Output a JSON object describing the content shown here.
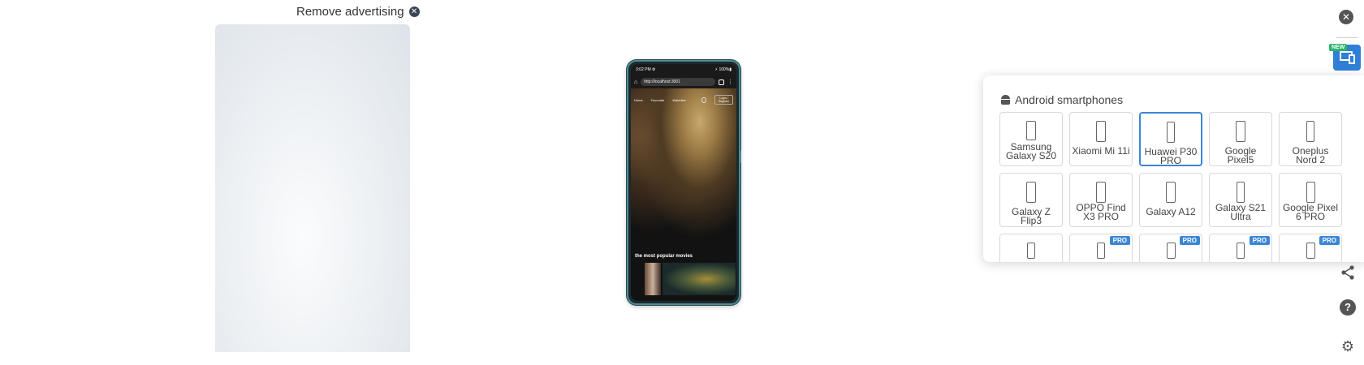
{
  "ad": {
    "remove_label": "Remove advertising",
    "close_glyph": "✕"
  },
  "phone": {
    "status_time": "3:02 PM ⚙",
    "status_battery": "⚡ 100%▮",
    "url": "http://localhost:3001",
    "nav_items": [
      "Home",
      "Favourite",
      "Watchlist"
    ],
    "login_label": "Login / Register",
    "section_title": "the most popular movies"
  },
  "popup": {
    "title": "Android smartphones",
    "icon": "android-icon",
    "devices": [
      {
        "label": "Samsung Galaxy S20",
        "pro": false,
        "selected": false
      },
      {
        "label": "Xiaomi Mi 11i",
        "pro": false,
        "selected": false
      },
      {
        "label": "Huawei P30 PRO",
        "pro": false,
        "selected": true
      },
      {
        "label": "Google Pixel5",
        "pro": false,
        "selected": false
      },
      {
        "label": "Oneplus Nord 2",
        "pro": false,
        "selected": false
      },
      {
        "label": "Galaxy Z Flip3",
        "pro": false,
        "selected": false
      },
      {
        "label": "OPPO Find X3 PRO",
        "pro": false,
        "selected": false
      },
      {
        "label": "Galaxy A12",
        "pro": false,
        "selected": false
      },
      {
        "label": "Galaxy S21 Ultra",
        "pro": false,
        "selected": false
      },
      {
        "label": "Google Pixel 6 PRO",
        "pro": false,
        "selected": false
      },
      {
        "label": "",
        "pro": false,
        "selected": false
      },
      {
        "label": "",
        "pro": true,
        "selected": false
      },
      {
        "label": "",
        "pro": true,
        "selected": false
      },
      {
        "label": "",
        "pro": true,
        "selected": false
      },
      {
        "label": "",
        "pro": true,
        "selected": false
      }
    ],
    "pro_label": "PRO"
  },
  "rail": {
    "close_glyph": "✕",
    "new_badge": "NEW",
    "share_glyph": "⋞",
    "help_glyph": "?",
    "settings_glyph": "⚙",
    "accent": "#2f7fd6"
  }
}
